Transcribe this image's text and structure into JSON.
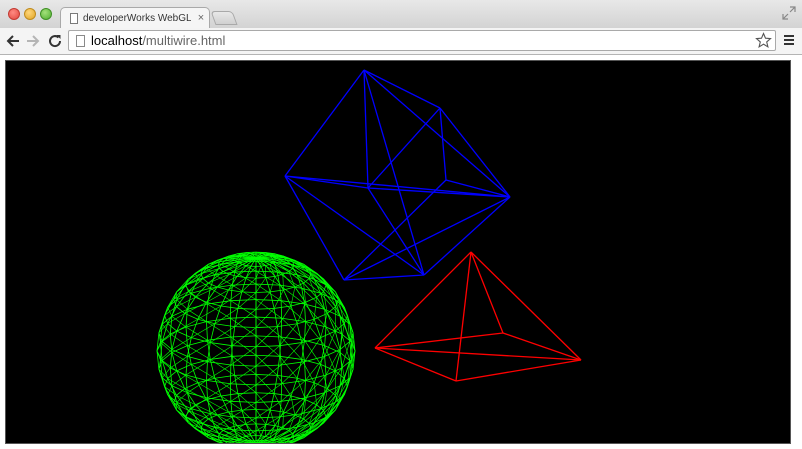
{
  "window": {
    "tab_title": "developerWorks WebGL Th",
    "tab_close": "×"
  },
  "toolbar": {
    "url_host": "localhost",
    "url_path": "/multiwire.html"
  },
  "scene": {
    "background": "#000000",
    "objects": [
      {
        "name": "wireframe-sphere",
        "color": "#00ff00"
      },
      {
        "name": "wireframe-cube",
        "color": "#0000ff"
      },
      {
        "name": "wireframe-pyramid",
        "color": "#ff0000"
      }
    ]
  },
  "icons": {
    "back": "back-arrow-icon",
    "forward": "forward-arrow-icon",
    "reload": "reload-icon",
    "bookmark": "star-icon",
    "menu": "hamburger-menu-icon",
    "fullscreen": "fullscreen-icon"
  }
}
